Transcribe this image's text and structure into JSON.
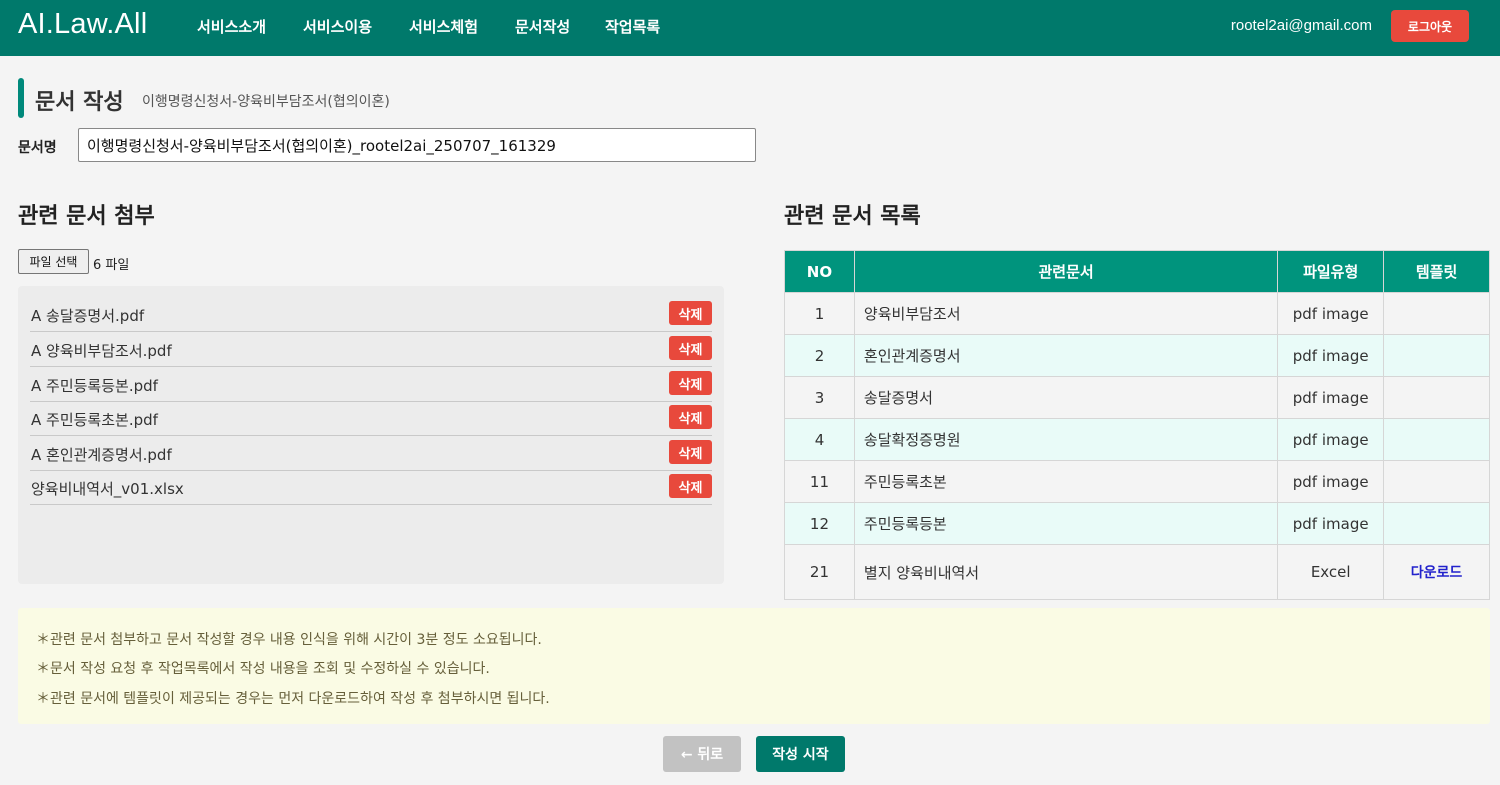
{
  "header": {
    "brand": "AI.Law.All",
    "nav": [
      "서비스소개",
      "서비스이용",
      "서비스체험",
      "문서작성",
      "작업목록"
    ],
    "email": "rootel2ai@gmail.com",
    "logout_label": "로그아웃"
  },
  "page": {
    "title": "문서 작성",
    "subtitle": "이행명령신청서-양육비부담조서(협의이혼)"
  },
  "docname": {
    "label": "문서명",
    "value": "이행명령신청서-양육비부담조서(협의이혼)_rootel2ai_250707_161329"
  },
  "attach": {
    "title": "관련 문서 첨부",
    "file_button_label": "파일 선택",
    "file_count": "6 파일",
    "delete_label": "삭제",
    "files": [
      "A 송달증명서.pdf",
      "A 양육비부담조서.pdf",
      "A 주민등록등본.pdf",
      "A 주민등록초본.pdf",
      "A 혼인관계증명서.pdf",
      "양육비내역서_v01.xlsx"
    ]
  },
  "related": {
    "title": "관련 문서 목록",
    "headers": [
      "NO",
      "관련문서",
      "파일유형",
      "템플릿"
    ],
    "rows": [
      {
        "no": "1",
        "name": "양육비부담조서",
        "type": "pdf image",
        "template": ""
      },
      {
        "no": "2",
        "name": "혼인관계증명서",
        "type": "pdf image",
        "template": ""
      },
      {
        "no": "3",
        "name": "송달증명서",
        "type": "pdf image",
        "template": ""
      },
      {
        "no": "4",
        "name": "송달확정증명원",
        "type": "pdf image",
        "template": ""
      },
      {
        "no": "11",
        "name": "주민등록초본",
        "type": "pdf image",
        "template": ""
      },
      {
        "no": "12",
        "name": "주민등록등본",
        "type": "pdf image",
        "template": ""
      },
      {
        "no": "21",
        "name": "별지 양육비내역서",
        "type": "Excel",
        "template": "다운로드"
      }
    ]
  },
  "notice": [
    "＊관련 문서 첨부하고 문서 작성할 경우 내용 인식을 위해 시간이 3분 정도 소요됩니다.",
    "＊문서 작성 요청 후 작업목록에서 작성 내용을 조회 및 수정하실 수 있습니다.",
    "＊관련 문서에 템플릿이 제공되는 경우는 먼저 다운로드하여 작성 후 첨부하시면 됩니다."
  ],
  "actions": {
    "back_label": "← 뒤로",
    "start_label": "작성 시작"
  },
  "colors": {
    "primary": "#00796b",
    "table_header": "#00947d",
    "danger": "#e8493c",
    "notice_bg": "#fafbe4"
  }
}
